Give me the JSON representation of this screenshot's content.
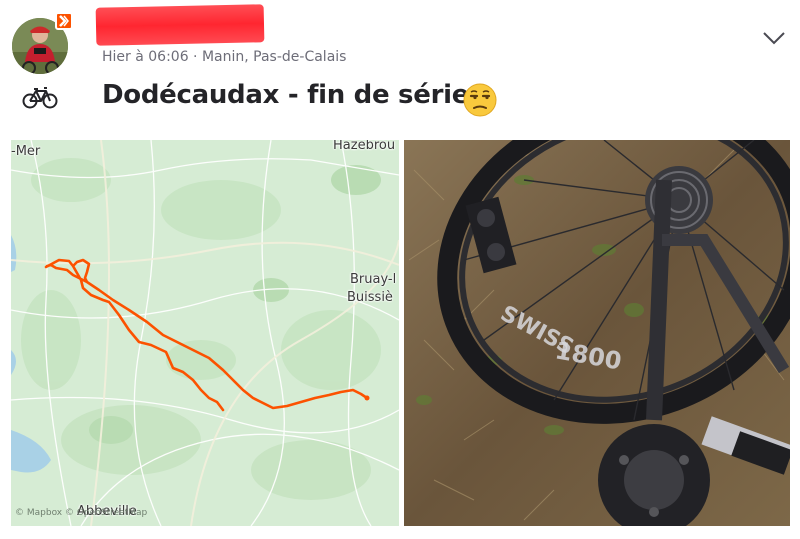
{
  "header": {
    "meta": "Hier à 06:06 · Manin, Pas-de-Calais"
  },
  "activity": {
    "title": "Dodécaudax - fin de série",
    "sport_icon": "bike-icon",
    "emoji": "unamused-face-emoji"
  },
  "map": {
    "labels": {
      "sur_mer": "-Mer",
      "hazebrouck": "Hazebrou",
      "bruay_1": "Bruay-l",
      "bruay_2": "Buissiè",
      "abbeville": "Abbeville"
    },
    "credit": "© Mapbox © OpenStreetMap",
    "route_color": "#fc5200"
  },
  "colors": {
    "brand": "#fc5200",
    "redaction": "#ff2630",
    "text_primary": "#242428",
    "text_secondary": "#6d6d78"
  }
}
